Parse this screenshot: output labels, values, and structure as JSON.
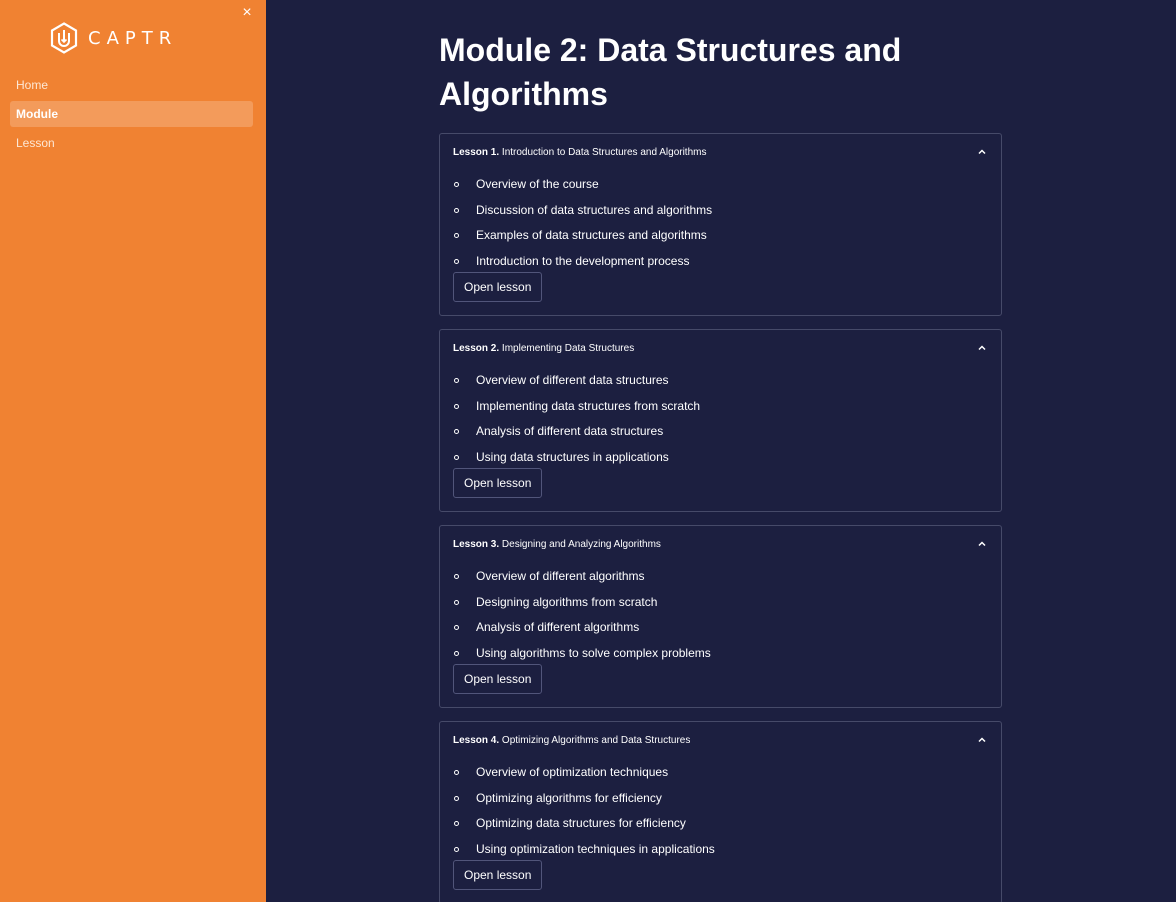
{
  "sidebar": {
    "brand": "CAPTR",
    "close_label": "×",
    "nav": [
      {
        "label": "Home"
      },
      {
        "label": "Module"
      },
      {
        "label": "Lesson"
      }
    ]
  },
  "main": {
    "title": "Module 2: Data Structures and Algorithms",
    "lessons": [
      {
        "number": "Lesson 1.",
        "title": "Introduction to Data Structures and Algorithms",
        "topics": [
          "Overview of the course",
          "Discussion of data structures and algorithms",
          "Examples of data structures and algorithms",
          "Introduction to the development process"
        ],
        "button": "Open lesson"
      },
      {
        "number": "Lesson 2.",
        "title": "Implementing Data Structures",
        "topics": [
          "Overview of different data structures",
          "Implementing data structures from scratch",
          "Analysis of different data structures",
          "Using data structures in applications"
        ],
        "button": "Open lesson"
      },
      {
        "number": "Lesson 3.",
        "title": "Designing and Analyzing Algorithms",
        "topics": [
          "Overview of different algorithms",
          "Designing algorithms from scratch",
          "Analysis of different algorithms",
          "Using algorithms to solve complex problems"
        ],
        "button": "Open lesson"
      },
      {
        "number": "Lesson 4.",
        "title": "Optimizing Algorithms and Data Structures",
        "topics": [
          "Overview of optimization techniques",
          "Optimizing algorithms for efficiency",
          "Optimizing data structures for efficiency",
          "Using optimization techniques in applications"
        ],
        "button": "Open lesson"
      }
    ]
  },
  "colors": {
    "sidebar_bg": "#f08232",
    "main_bg": "#1c1f40",
    "card_border": "#464a69"
  }
}
